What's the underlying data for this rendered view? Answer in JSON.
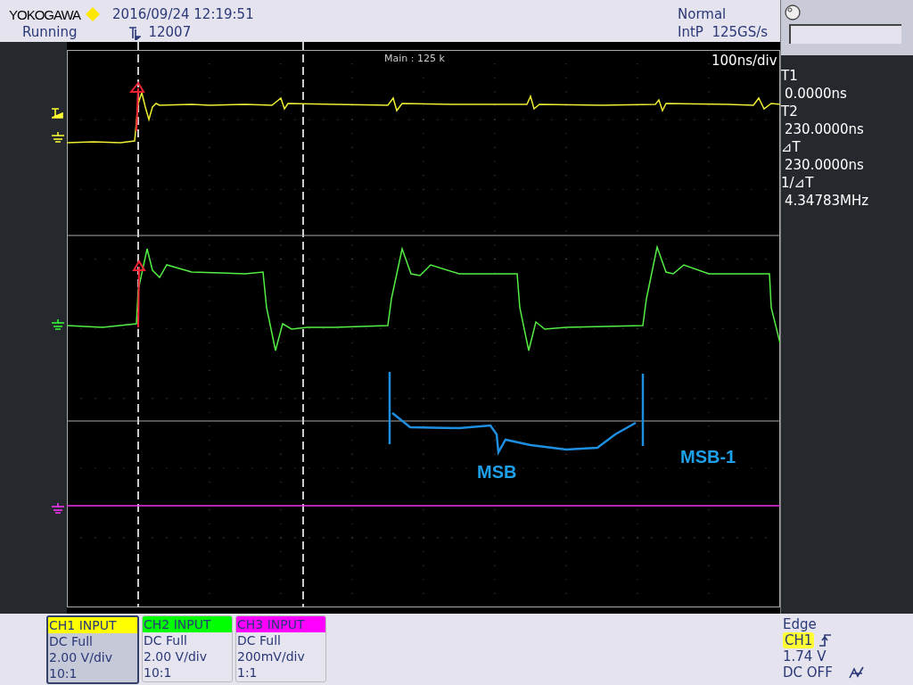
{
  "header": {
    "brand": "YOKOGAWA",
    "datetime": "2016/09/24 12:19:51",
    "status": "Running",
    "trigger_count": "12007",
    "mode": "Normal",
    "sampling": "IntP  125GS/s"
  },
  "plot": {
    "main_label": "Main : 125 k",
    "timebase": "100ns/div",
    "annotations": [
      {
        "text": "MSB"
      },
      {
        "text": "MSB-1"
      }
    ]
  },
  "cursors": [
    {
      "label": "T1",
      "value": "0.0000ns"
    },
    {
      "label": "T2",
      "value": "230.0000ns"
    },
    {
      "label": "⊿T",
      "value": "230.0000ns"
    },
    {
      "label": "1/⊿T",
      "value": "4.34783MHz"
    }
  ],
  "channels": [
    {
      "label": "CH1 INPUT",
      "color": "#ffff00",
      "selected": true,
      "coupling": "DC Full",
      "scale": "2.00 V/div",
      "probe": "10:1"
    },
    {
      "label": "CH2 INPUT",
      "color": "#00ff00",
      "selected": false,
      "coupling": "DC Full",
      "scale": "2.00 V/div",
      "probe": "10:1"
    },
    {
      "label": "CH3 INPUT",
      "color": "#ff00ff",
      "selected": false,
      "coupling": "DC Full",
      "scale": "200mV/div",
      "probe": "1:1"
    }
  ],
  "trigger": {
    "type": "Edge",
    "source": "CH1",
    "level": "1.74 V",
    "coupling": "DC OFF"
  }
}
